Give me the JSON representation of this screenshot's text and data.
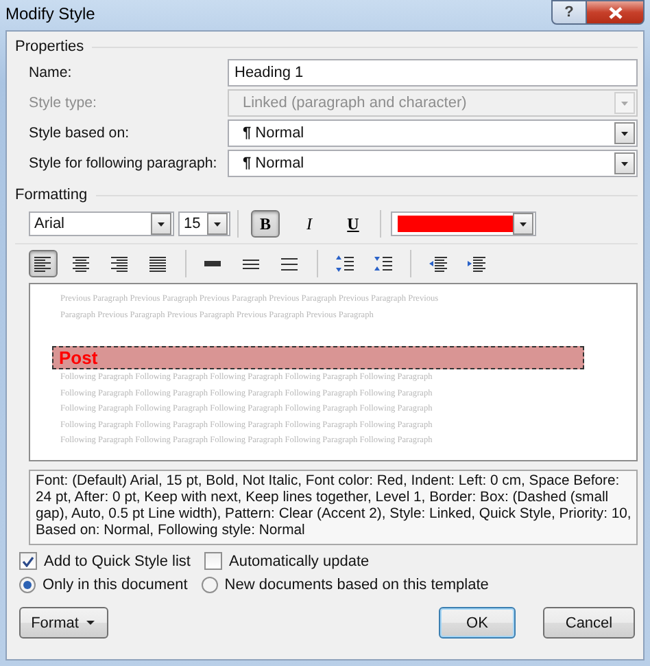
{
  "window": {
    "title": "Modify Style",
    "help": "?"
  },
  "properties": {
    "title": "Properties",
    "rows": [
      {
        "label": "Name:",
        "kind": "text",
        "value": "Heading 1"
      },
      {
        "label": "Style type:",
        "kind": "select",
        "value": "Linked (paragraph and character)",
        "disabled": true
      },
      {
        "label": "Style based on:",
        "kind": "select",
        "value": "**¶** Normal",
        "disabled": false
      },
      {
        "label": "Style for following paragraph:",
        "kind": "select",
        "value": "**¶** Normal",
        "disabled": false
      }
    ]
  },
  "formatting": {
    "title": "Formatting",
    "font": "Arial",
    "size": "15",
    "toggles": [
      {
        "label": "B",
        "kind": "bold",
        "selected": true
      },
      {
        "label": "I",
        "kind": "italic",
        "selected": false
      },
      {
        "label": "U",
        "kind": "underline",
        "selected": false
      }
    ],
    "color_picker": {
      "color": "#ff0000"
    },
    "tools": [
      {
        "kind": "align-left",
        "selected": true
      },
      {
        "kind": "align-center",
        "selected": false
      },
      {
        "kind": "align-right",
        "selected": false
      },
      {
        "kind": "justify",
        "selected": false
      },
      {
        "kind": "spacing-single",
        "selected": false
      },
      {
        "kind": "spacing-half",
        "selected": false
      },
      {
        "kind": "spacing-double",
        "selected": false
      },
      {
        "kind": "space-increase",
        "selected": false
      },
      {
        "kind": "space-decrease",
        "selected": false
      },
      {
        "kind": "indent-decrease",
        "selected": false
      },
      {
        "kind": "indent-increase",
        "selected": false
      }
    ]
  },
  "preview": {
    "previous": [
      "Previous Paragraph Previous Paragraph Previous Paragraph Previous Paragraph Previous Paragraph Previous",
      "Paragraph Previous Paragraph Previous Paragraph Previous Paragraph Previous Paragraph"
    ],
    "sample": "Post",
    "following": [
      "Following Paragraph Following Paragraph Following Paragraph Following Paragraph Following Paragraph",
      "Following Paragraph Following Paragraph Following Paragraph Following Paragraph Following Paragraph",
      "Following Paragraph Following Paragraph Following Paragraph Following Paragraph Following Paragraph",
      "Following Paragraph Following Paragraph Following Paragraph Following Paragraph Following Paragraph",
      "Following Paragraph Following Paragraph Following Paragraph Following Paragraph Following Paragraph"
    ]
  },
  "description": "Font: (Default) Arial, 15 pt, Bold, Not Italic, Font color: Red, Indent: Left:  0 cm, Space Before:  24 pt, After:  0 pt, Keep with next, Keep lines together, Level 1, Border: Box: (Dashed (small gap), Auto,  0.5 pt Line width), Pattern: Clear (Accent 2), Style: Linked, Quick Style, Priority: 10, Based on: Normal, Following style: Normal",
  "checkboxes": [
    {
      "label": "Add to Quick Style list",
      "checked": true
    },
    {
      "label": "Automatically update",
      "checked": false
    }
  ],
  "radios": [
    {
      "label": "Only in this document",
      "selected": true
    },
    {
      "label": "New documents based on this template",
      "selected": false
    }
  ],
  "buttons": [
    {
      "label": "Format",
      "kind": "menu"
    },
    {
      "label": "OK",
      "kind": "default"
    },
    {
      "label": "Cancel",
      "kind": "normal"
    }
  ]
}
